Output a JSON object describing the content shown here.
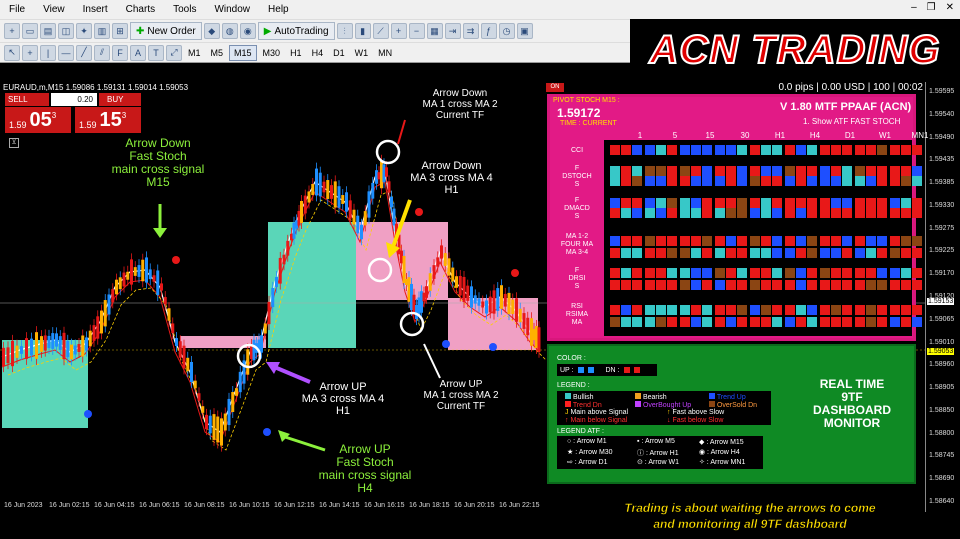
{
  "menubar": {
    "items": [
      "File",
      "View",
      "Insert",
      "Charts",
      "Tools",
      "Window",
      "Help"
    ]
  },
  "toolbar": {
    "new_order": "New Order",
    "autotrading": "AutoTrading"
  },
  "timeframes": [
    "M1",
    "M5",
    "M15",
    "M30",
    "H1",
    "H4",
    "D1",
    "W1",
    "MN"
  ],
  "active_timeframe": "M15",
  "logo": "ACN TRADING",
  "chart": {
    "symbol_line": "EURAUD,m,M15  1.59086 1.59131 1.59014 1.59053",
    "trade": {
      "sell_label": "SELL",
      "buy_label": "BUY",
      "lot": "0.20",
      "sell_small": "1.59",
      "sell_big": "05",
      "sell_sup": "3",
      "buy_small": "1.59",
      "buy_big": "15",
      "buy_sup": "3"
    },
    "annotations": {
      "a1": "Arrow Down\nFast Stoch\nmain cross signal\nM15",
      "a2": "Arrow Down\nMA 1 cross MA 2\nCurrent TF",
      "a3": "Arrow Down\nMA 3 cross MA 4\nH1",
      "a4": "Arrow UP\nMA 3 cross MA 4\nH1",
      "a5": "Arrow UP\nMA 1 cross MA 2\nCurrent TF",
      "a6": "Arrow UP\nFast Stoch\nmain cross signal\nH4"
    },
    "price_axis": [
      "1.59595",
      "1.59540",
      "1.59490",
      "1.59435",
      "1.59385",
      "1.59330",
      "1.59275",
      "1.59225",
      "1.59170",
      "1.59120",
      "1.59065",
      "1.59010",
      "1.58960",
      "1.58905",
      "1.58850",
      "1.58800",
      "1.58745",
      "1.58690",
      "1.58640"
    ],
    "current_price": "1.59153",
    "bid_price": "1.59053",
    "time_axis": [
      "16 Jun 2023",
      "16 Jun 02:15",
      "16 Jun 04:15",
      "16 Jun 06:15",
      "16 Jun 08:15",
      "16 Jun 10:15",
      "16 Jun 12:15",
      "16 Jun 14:15",
      "16 Jun 16:15",
      "16 Jun 18:15",
      "16 Jun 20:15",
      "16 Jun 22:15"
    ]
  },
  "status": {
    "on": "ON",
    "text": "0.0 pips | 0.00 USD | 100 | 00:02"
  },
  "dashboard": {
    "title": "PIVOT STOCH M15 :",
    "price": "1.59172",
    "time": "TIME : CURRENT",
    "version": "V 1.80 MTF PPAAF (ACN)",
    "show": "1. Show ATF FAST STOCH",
    "headers": [
      "1",
      "5",
      "15",
      "30",
      "H1",
      "H4",
      "D1",
      "W1",
      "MN1"
    ],
    "rows": [
      "CCI",
      "F\nDSTOCH\nS",
      "F\nDMACD\nS",
      "MA 1-2\nFOUR MA\nMA 3-4",
      "F\nDRSI\nS",
      "RSI\nRSIMA\nMA"
    ]
  },
  "promo": {
    "color_label": "COLOR :",
    "up": "UP :",
    "dn": "DN :",
    "legend_label": "LEGEND :",
    "legend": [
      "Bullish",
      "Bearish",
      "Trend Up",
      "Trend Dn",
      "OverBought Up",
      "OverSold Dn",
      "Main above Signal",
      "Fast above Slow",
      "Main below Signal",
      "Fast below Slow"
    ],
    "atf_label": "LEGEND ATF :",
    "atf": [
      "Arrow M1",
      "Arrow M5",
      "Arrow M15",
      "Arrow M30",
      "Arrow H1",
      "Arrow H4",
      "Arrow D1",
      "Arrow W1",
      "Arrow MN1"
    ],
    "realtime": "REAL TIME\n9TF\nDASHBOARD\nMONITOR"
  },
  "footer": "Trading is about waiting the arrows to come\nand monitoring all 9TF dashboard",
  "colors": {
    "bull": "#1e8fff",
    "bear": "#e81818",
    "teal_zone": "#5ad6b8",
    "pink_zone": "#f0a0c4",
    "dash_bg": "#e21a86",
    "promo_bg": "#0f8a24",
    "logo": "#e00000"
  }
}
